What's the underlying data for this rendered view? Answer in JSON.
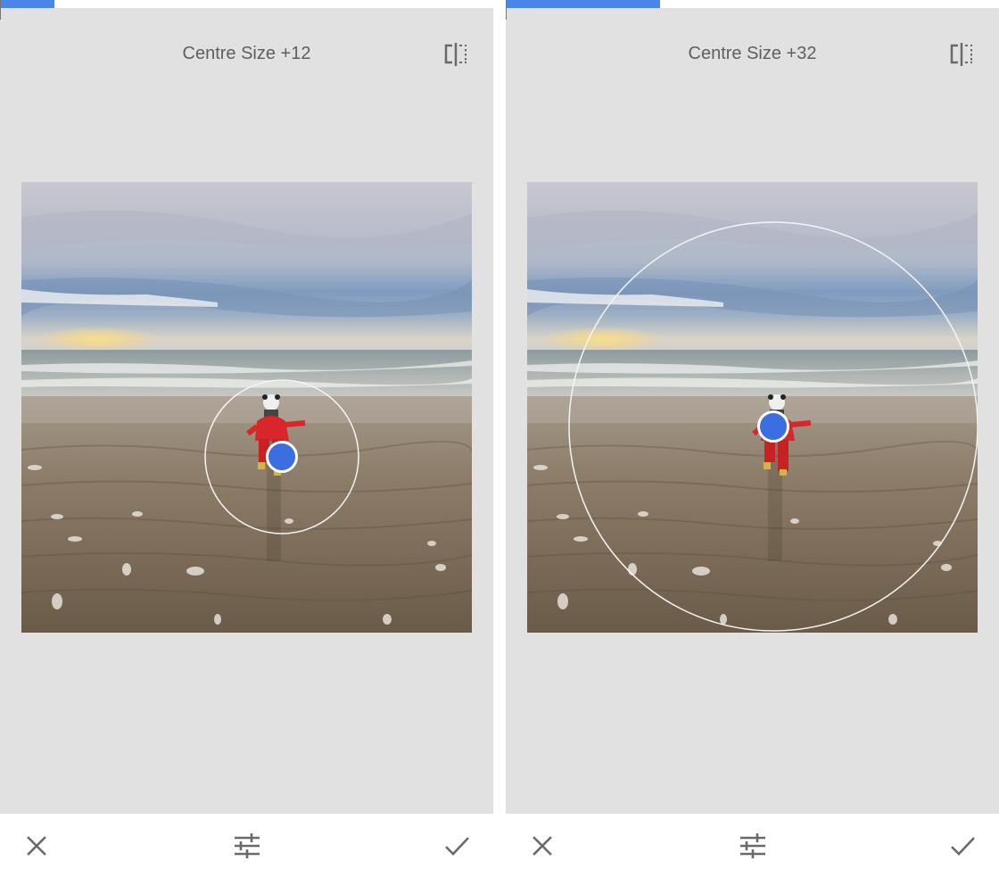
{
  "colors": {
    "accent": "#4a86e8",
    "canvas_background": "#e1e1e1",
    "toolbar_background": "#ffffff",
    "text": "#5f5f5f"
  },
  "panels": [
    {
      "title": "Centre Size +12",
      "progress_fraction": 0.11,
      "compare_icon": "compare-split-icon",
      "photo_description_icon": "beach-photo",
      "toolbar": {
        "cancel_icon": "close-icon",
        "adjust_icon": "sliders-icon",
        "apply_icon": "checkmark-icon"
      }
    },
    {
      "title": "Centre Size +32",
      "progress_fraction": 0.31,
      "compare_icon": "compare-split-icon",
      "photo_description_icon": "beach-photo",
      "toolbar": {
        "cancel_icon": "close-icon",
        "adjust_icon": "sliders-icon",
        "apply_icon": "checkmark-icon"
      }
    }
  ]
}
